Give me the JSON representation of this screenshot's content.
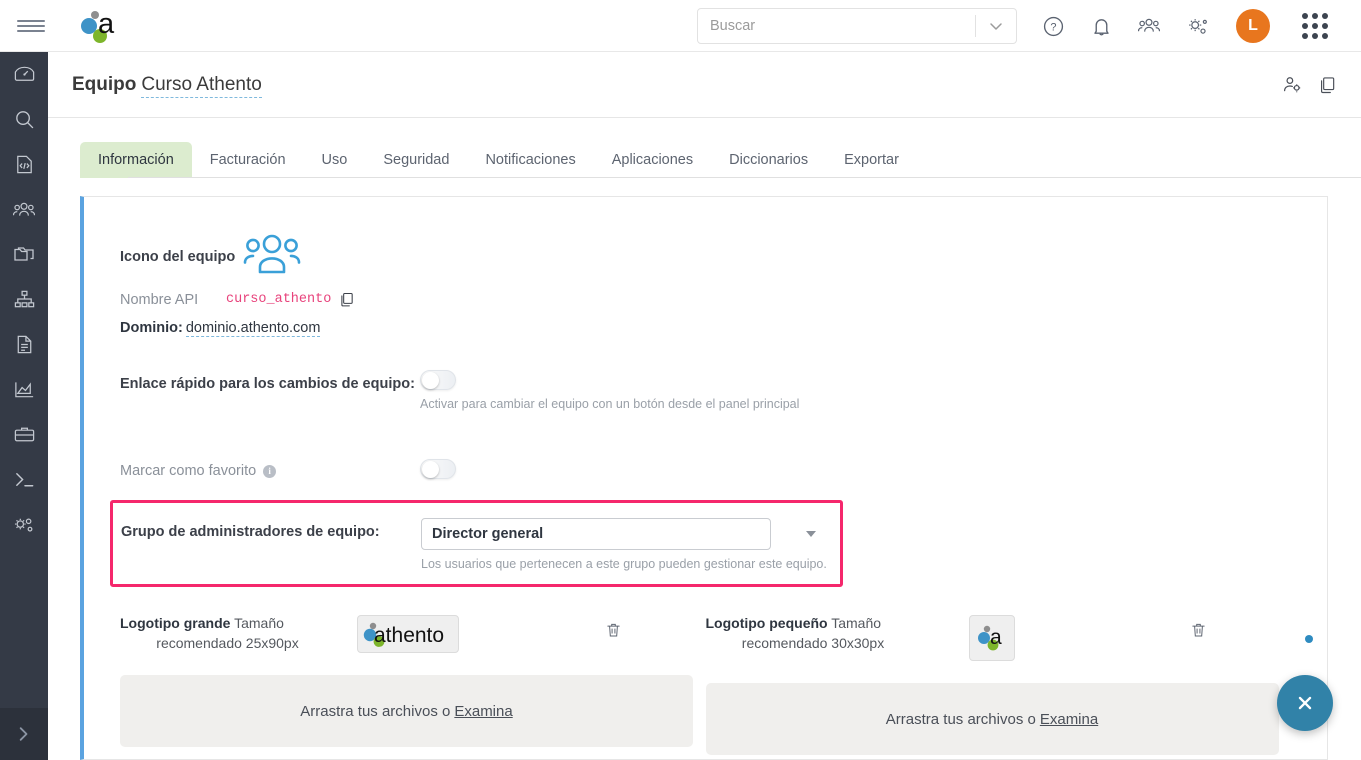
{
  "topbar": {
    "menu_icon": "hamburger-menu-icon",
    "brand_icon": "athento-logo",
    "search": {
      "placeholder": "Buscar",
      "value": ""
    },
    "icons": [
      {
        "name": "help-icon",
        "label": "?"
      },
      {
        "name": "notifications-bell-icon",
        "label": ""
      },
      {
        "name": "users-icon",
        "label": ""
      },
      {
        "name": "settings-gear-icon",
        "label": ""
      }
    ],
    "avatar_initial": "L",
    "avatar_color": "#e8761e",
    "apps_icon": "apps-grid-icon"
  },
  "sidebar": {
    "items": [
      {
        "name": "sidebar-item-dashboard",
        "icon": "gauge-icon"
      },
      {
        "name": "sidebar-item-search",
        "icon": "search-icon"
      },
      {
        "name": "sidebar-item-code-file",
        "icon": "code-file-icon"
      },
      {
        "name": "sidebar-item-users",
        "icon": "users-icon"
      },
      {
        "name": "sidebar-item-folders",
        "icon": "folder-icon"
      },
      {
        "name": "sidebar-item-sitemap",
        "icon": "sitemap-icon"
      },
      {
        "name": "sidebar-item-documents",
        "icon": "document-icon"
      },
      {
        "name": "sidebar-item-analytics",
        "icon": "chart-area-icon"
      },
      {
        "name": "sidebar-item-briefcase",
        "icon": "briefcase-icon"
      },
      {
        "name": "sidebar-item-terminal",
        "icon": "terminal-icon"
      },
      {
        "name": "sidebar-item-settings",
        "icon": "gears-icon"
      }
    ],
    "expand_icon": "chevron-right-icon"
  },
  "header": {
    "title_prefix": "Equipo",
    "team_name": "Curso Athento",
    "actions": [
      {
        "name": "manage-users-icon",
        "icon": "user-gear-icon"
      },
      {
        "name": "duplicate-icon",
        "icon": "copy-icon"
      }
    ]
  },
  "tabs": [
    {
      "label": "Información",
      "active": true
    },
    {
      "label": "Facturación",
      "active": false
    },
    {
      "label": "Uso",
      "active": false
    },
    {
      "label": "Seguridad",
      "active": false
    },
    {
      "label": "Notificaciones",
      "active": false
    },
    {
      "label": "Aplicaciones",
      "active": false
    },
    {
      "label": "Diccionarios",
      "active": false
    },
    {
      "label": "Exportar",
      "active": false
    }
  ],
  "form": {
    "team_icon_label": "Icono del equipo",
    "team_icon_name": "team-group-icon",
    "api_label": "Nombre API",
    "api_value": "curso_athento",
    "copy_icon": "copy-icon",
    "domain_label": "Dominio:",
    "domain_value": "dominio.athento.com",
    "quick_link": {
      "label": "Enlace rápido para los cambios de equipo:",
      "hint": "Activar para cambiar el equipo con un botón desde el panel principal",
      "enabled": false
    },
    "favorite": {
      "label": "Marcar como favorito",
      "info_icon": "info-icon",
      "enabled": false
    },
    "admin_group": {
      "label": "Grupo de administradores de equipo:",
      "selected": "Director general",
      "hint": "Los usuarios que pertenecen a este grupo pueden gestionar este equipo.",
      "highlight_color": "#f5276c"
    }
  },
  "logos": {
    "large": {
      "title": "Logotipo grande",
      "size_text_1": "Tamaño",
      "size_text_2": "recomendado 25x90px",
      "thumb_name": "athento-large-logo-thumb",
      "delete_icon": "trash-icon",
      "dropzone_text": "Arrastra tus archivos o ",
      "dropzone_link": "Examina"
    },
    "small": {
      "title": "Logotipo pequeño",
      "size_text_1": "Tamaño",
      "size_text_2": "recomendado 30x30px",
      "thumb_name": "athento-small-logo-thumb",
      "delete_icon": "trash-icon",
      "dropzone_text": "Arrastra tus archivos o ",
      "dropzone_link": "Examina"
    }
  },
  "fab": {
    "icon": "close-icon",
    "color": "#3182a8"
  }
}
